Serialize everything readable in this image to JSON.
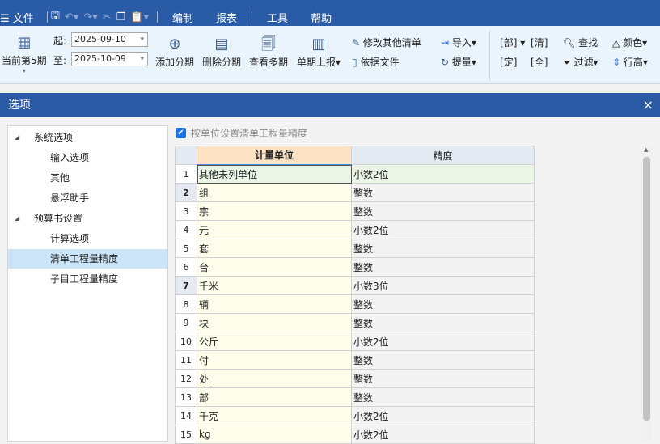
{
  "menu": {
    "file": "文件",
    "tabs": [
      "编制",
      "报表",
      "工具",
      "帮助"
    ],
    "active": "编制"
  },
  "ribbon": {
    "period": "当前第5期",
    "start_label": "起:",
    "start_date": "2025-09-10",
    "end_label": "至:",
    "end_date": "2025-10-09",
    "add_period": "添加分期",
    "delete_period": "删除分期",
    "view_periods": "查看多期",
    "report": "单期上报",
    "modify_other": "修改其他清单",
    "basis_file": "依据文件",
    "import": "导入",
    "extract": "提量",
    "bu": "部",
    "qing": "清",
    "ding": "定",
    "quan": "全",
    "find": "查找",
    "filter": "过滤",
    "color": "颜色",
    "row_height": "行高"
  },
  "dialog": {
    "title": "选项",
    "close": "×",
    "tree": [
      {
        "label": "系统选项",
        "level": 0
      },
      {
        "label": "输入选项",
        "level": 1
      },
      {
        "label": "其他",
        "level": 1
      },
      {
        "label": "悬浮助手",
        "level": 1
      },
      {
        "label": "预算书设置",
        "level": 0
      },
      {
        "label": "计算选项",
        "level": 1
      },
      {
        "label": "清单工程量精度",
        "level": 1,
        "selected": true
      },
      {
        "label": "子目工程量精度",
        "level": 1
      }
    ],
    "checkbox_label": "按单位设置清单工程量精度",
    "checkbox_checked": true,
    "columns": [
      "计量单位",
      "精度"
    ],
    "rows": [
      {
        "n": "1",
        "unit": "其他未列单位",
        "precision": "小数2位"
      },
      {
        "n": "2",
        "unit": "组",
        "precision": "整数"
      },
      {
        "n": "3",
        "unit": "宗",
        "precision": "整数"
      },
      {
        "n": "4",
        "unit": "元",
        "precision": "小数2位"
      },
      {
        "n": "5",
        "unit": "套",
        "precision": "整数"
      },
      {
        "n": "6",
        "unit": "台",
        "precision": "整数"
      },
      {
        "n": "7",
        "unit": "千米",
        "precision": "小数3位"
      },
      {
        "n": "8",
        "unit": "辆",
        "precision": "整数"
      },
      {
        "n": "9",
        "unit": "块",
        "precision": "整数"
      },
      {
        "n": "10",
        "unit": "公斤",
        "precision": "小数2位"
      },
      {
        "n": "11",
        "unit": "付",
        "precision": "整数"
      },
      {
        "n": "12",
        "unit": "处",
        "precision": "整数"
      },
      {
        "n": "13",
        "unit": "部",
        "precision": "整数"
      },
      {
        "n": "14",
        "unit": "千克",
        "precision": "小数2位"
      },
      {
        "n": "15",
        "unit": "kg",
        "precision": "小数2位"
      }
    ]
  }
}
